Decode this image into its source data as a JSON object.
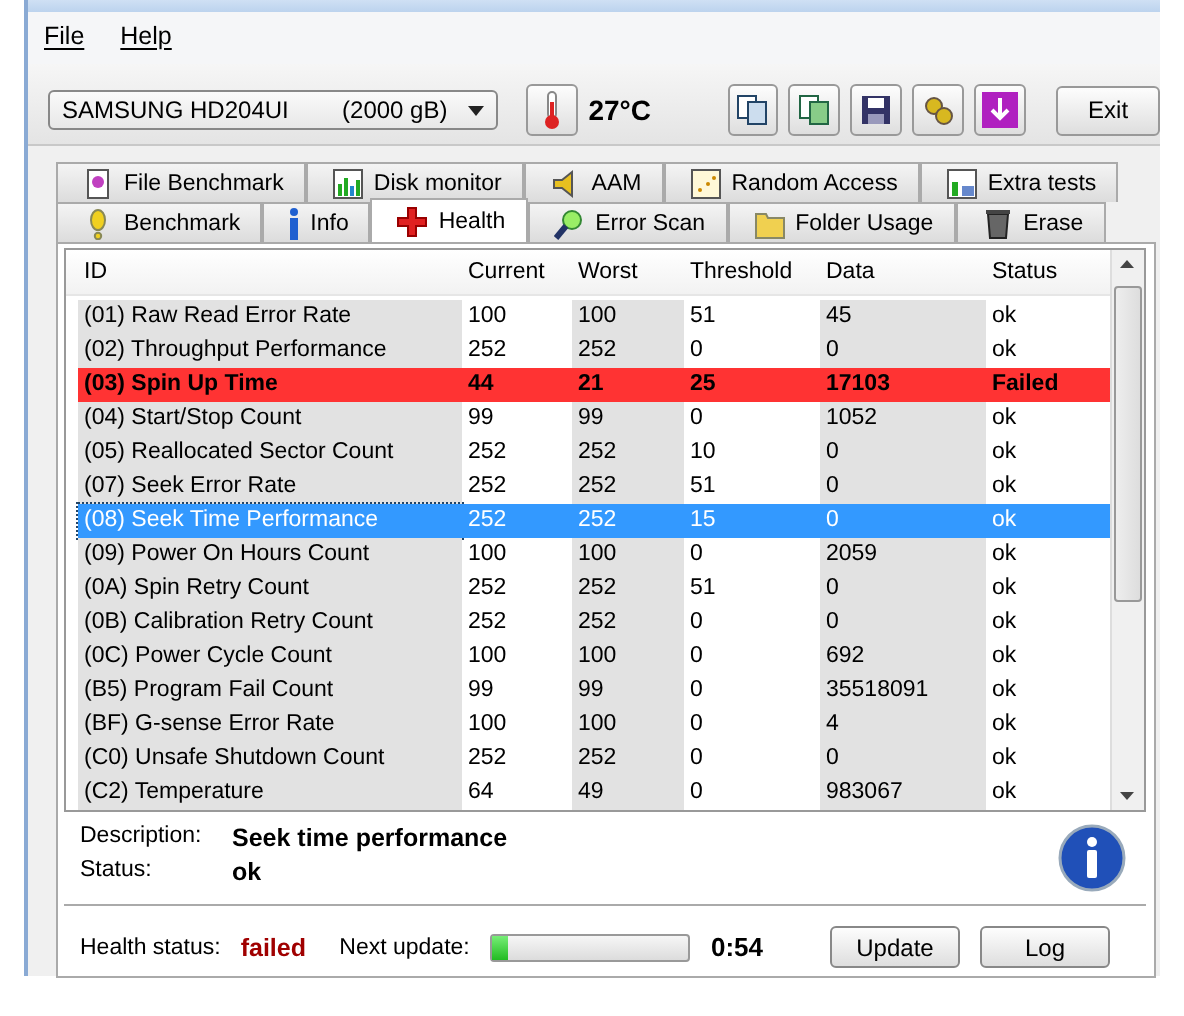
{
  "menu": [
    "File",
    "Help"
  ],
  "toolbar": {
    "drive": "SAMSUNG HD204UI        (2000 gB)",
    "temperature": "27°C",
    "exit_button": "Exit"
  },
  "tabs_back": [
    {
      "label": "File Benchmark",
      "selected": false
    },
    {
      "label": "Disk monitor",
      "selected": false
    },
    {
      "label": "AAM",
      "selected": false
    },
    {
      "label": "Random Access",
      "selected": false
    },
    {
      "label": "Extra tests",
      "selected": false
    }
  ],
  "tabs_front": [
    {
      "label": "Benchmark",
      "selected": false
    },
    {
      "label": "Info",
      "selected": false
    },
    {
      "label": "Health",
      "selected": true
    },
    {
      "label": "Error Scan",
      "selected": false
    },
    {
      "label": "Folder Usage",
      "selected": false
    },
    {
      "label": "Erase",
      "selected": false
    }
  ],
  "table": {
    "columns": [
      "ID",
      "Current",
      "Worst",
      "Threshold",
      "Data",
      "Status"
    ],
    "rows": [
      {
        "cells": [
          "(01) Raw Read Error Rate",
          "100",
          "100",
          "51",
          "45",
          "ok"
        ],
        "kind": "normal",
        "selected": false
      },
      {
        "cells": [
          "(02) Throughput Performance",
          "252",
          "252",
          "0",
          "0",
          "ok"
        ],
        "kind": "normal",
        "selected": false
      },
      {
        "cells": [
          "(03) Spin Up Time",
          "44",
          "21",
          "25",
          "17103",
          "Failed"
        ],
        "kind": "failed",
        "selected": false
      },
      {
        "cells": [
          "(04) Start/Stop Count",
          "99",
          "99",
          "0",
          "1052",
          "ok"
        ],
        "kind": "normal",
        "selected": false
      },
      {
        "cells": [
          "(05) Reallocated Sector Count",
          "252",
          "252",
          "10",
          "0",
          "ok"
        ],
        "kind": "normal",
        "selected": false
      },
      {
        "cells": [
          "(07) Seek Error Rate",
          "252",
          "252",
          "51",
          "0",
          "ok"
        ],
        "kind": "normal",
        "selected": false
      },
      {
        "cells": [
          "(08) Seek Time Performance",
          "252",
          "252",
          "15",
          "0",
          "ok"
        ],
        "kind": "normal",
        "selected": true
      },
      {
        "cells": [
          "(09) Power On Hours Count",
          "100",
          "100",
          "0",
          "2059",
          "ok"
        ],
        "kind": "normal",
        "selected": false
      },
      {
        "cells": [
          "(0A) Spin Retry Count",
          "252",
          "252",
          "51",
          "0",
          "ok"
        ],
        "kind": "normal",
        "selected": false
      },
      {
        "cells": [
          "(0B) Calibration Retry Count",
          "252",
          "252",
          "0",
          "0",
          "ok"
        ],
        "kind": "normal",
        "selected": false
      },
      {
        "cells": [
          "(0C) Power Cycle Count",
          "100",
          "100",
          "0",
          "692",
          "ok"
        ],
        "kind": "normal",
        "selected": false
      },
      {
        "cells": [
          "(B5) Program Fail Count",
          "99",
          "99",
          "0",
          "35518091",
          "ok"
        ],
        "kind": "normal",
        "selected": false
      },
      {
        "cells": [
          "(BF) G-sense Error Rate",
          "100",
          "100",
          "0",
          "4",
          "ok"
        ],
        "kind": "normal",
        "selected": false
      },
      {
        "cells": [
          "(C0) Unsafe Shutdown Count",
          "252",
          "252",
          "0",
          "0",
          "ok"
        ],
        "kind": "normal",
        "selected": false
      },
      {
        "cells": [
          "(C2) Temperature",
          "64",
          "49",
          "0",
          "983067",
          "ok"
        ],
        "kind": "normal",
        "selected": false
      }
    ]
  },
  "details": {
    "description_label": "Description:",
    "description": "Seek time performance",
    "status_label": "Status:",
    "status": "ok"
  },
  "status_bar": {
    "health_label": "Health status:",
    "health": "failed",
    "next_label": "Next update:",
    "level": 0.08,
    "countdown": "0:54",
    "update_button": "Update",
    "log_button": "Log"
  }
}
